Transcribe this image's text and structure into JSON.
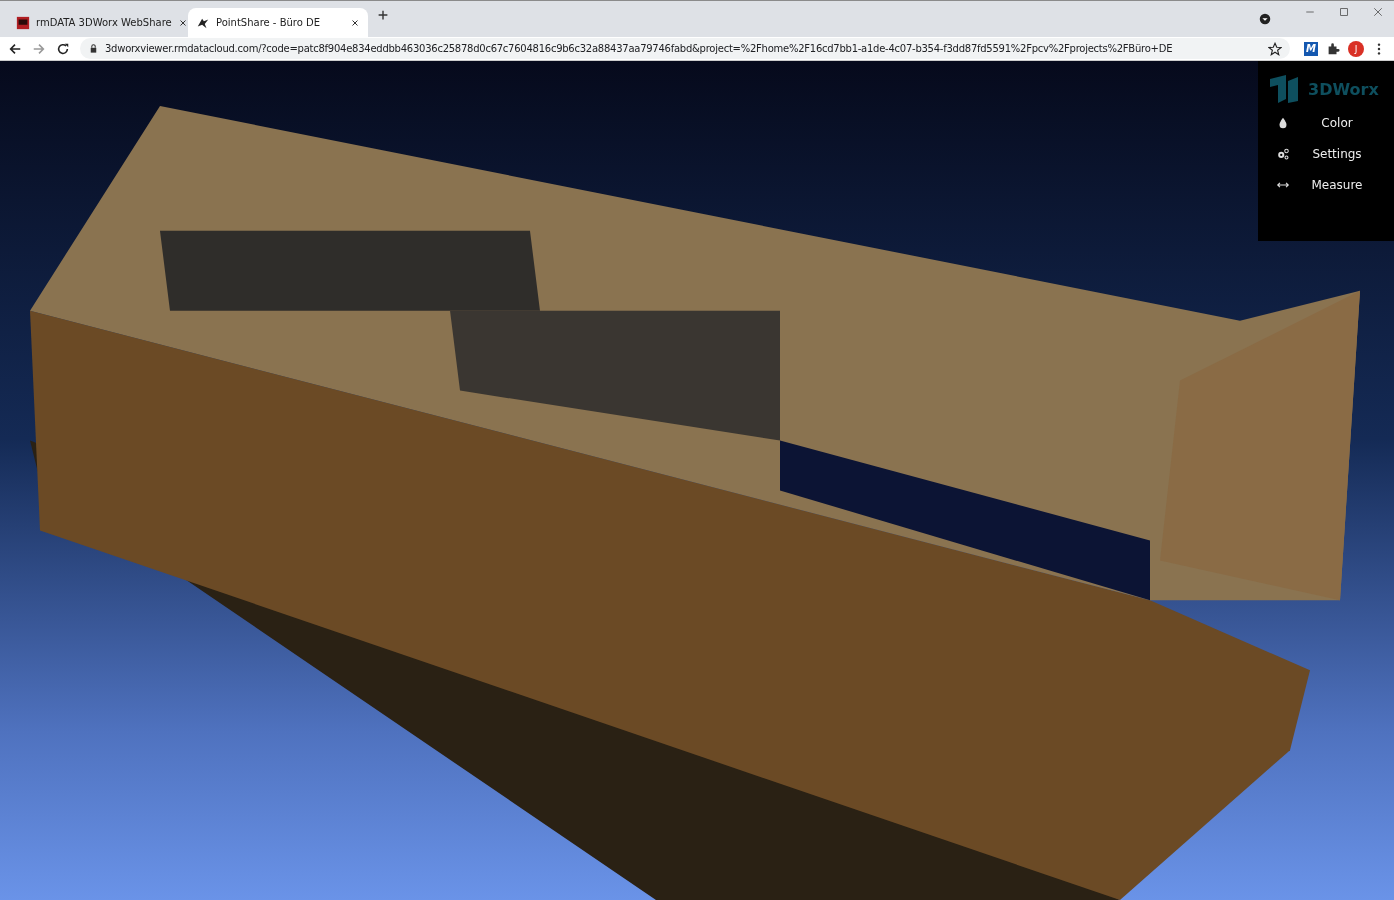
{
  "browser": {
    "tabs": [
      {
        "title": "rmDATA 3DWorx WebShare",
        "selected": false
      },
      {
        "title": "PointShare - Büro DE",
        "selected": true
      }
    ],
    "address": "3dworxviewer.rmdatacloud.com/?code=patc8f904e834eddbb463036c25878d0c67c7604816c9b6c32a88437aa79746fabd&project=%2Fhome%2F16cd7bb1-a1de-4c07-b354-f3dd87fd5591%2Fpcv%2Fprojects%2FBüro+DE",
    "extension_label": "M",
    "profile_initial": "J"
  },
  "panel": {
    "logo_text": "3DWorx",
    "items": [
      {
        "label": "Color",
        "kind": "color"
      },
      {
        "label": "Settings",
        "kind": "settings"
      },
      {
        "label": "Measure",
        "kind": "measure"
      }
    ]
  }
}
